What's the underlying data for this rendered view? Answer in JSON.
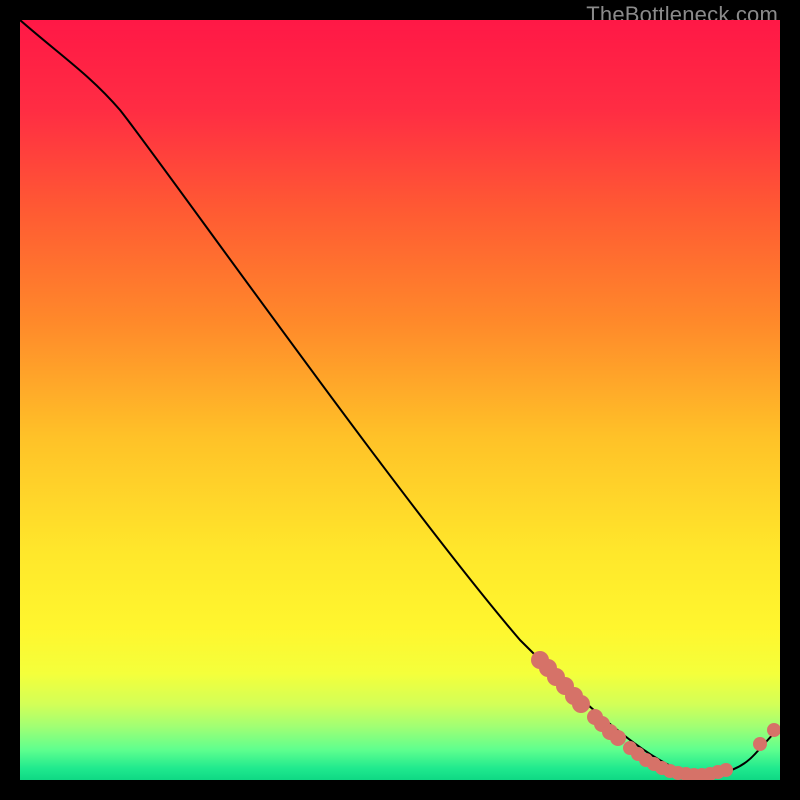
{
  "watermark": "TheBottleneck.com",
  "colors": {
    "page_bg": "#000000",
    "curve": "#000000",
    "marker": "#d67268",
    "gradient_stops": [
      {
        "offset": 0.0,
        "color": "#ff1846"
      },
      {
        "offset": 0.12,
        "color": "#ff2d43"
      },
      {
        "offset": 0.25,
        "color": "#ff5a33"
      },
      {
        "offset": 0.4,
        "color": "#ff8a2a"
      },
      {
        "offset": 0.55,
        "color": "#ffc228"
      },
      {
        "offset": 0.7,
        "color": "#ffe72b"
      },
      {
        "offset": 0.8,
        "color": "#fff62e"
      },
      {
        "offset": 0.86,
        "color": "#f4ff3b"
      },
      {
        "offset": 0.9,
        "color": "#d3ff57"
      },
      {
        "offset": 0.93,
        "color": "#a0ff74"
      },
      {
        "offset": 0.96,
        "color": "#5fff8e"
      },
      {
        "offset": 0.985,
        "color": "#1fe98e"
      },
      {
        "offset": 1.0,
        "color": "#0fd884"
      }
    ]
  },
  "chart_data": {
    "type": "line",
    "title": "",
    "xlabel": "",
    "ylabel": "",
    "xlim": [
      0,
      100
    ],
    "ylim": [
      0,
      100
    ],
    "note": "No axes or tick labels shown. Values below are read off the 760×760 plot area and scaled to 0–100. y is plotted with 0 at top (higher y = lower on screen).",
    "series": [
      {
        "name": "curve",
        "x": [
          0,
          13,
          66,
          87,
          99
        ],
        "y": [
          0,
          12,
          82,
          99,
          94
        ]
      },
      {
        "name": "markers",
        "x": [
          68,
          69,
          71,
          72,
          73,
          74,
          76,
          77,
          78,
          79,
          80,
          81,
          82,
          83,
          84,
          86,
          87,
          88,
          89,
          90,
          91,
          92,
          93,
          97,
          99
        ],
        "y": [
          84,
          85,
          86,
          88,
          89,
          90,
          92,
          93,
          94,
          94,
          96,
          97,
          97,
          98,
          98,
          99,
          99,
          99,
          99,
          99,
          99,
          99,
          99,
          95,
          93
        ]
      }
    ]
  }
}
